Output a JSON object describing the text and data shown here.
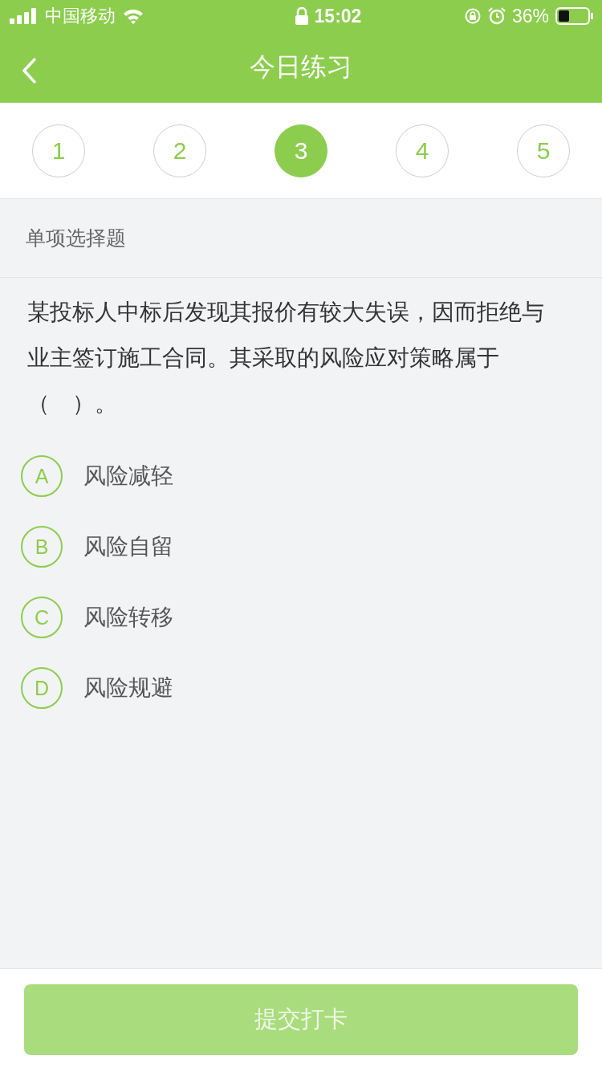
{
  "status_bar": {
    "carrier": "中国移动",
    "time": "15:02",
    "battery": "36%"
  },
  "nav": {
    "title": "今日练习"
  },
  "steps": [
    {
      "label": "1",
      "selected": false
    },
    {
      "label": "2",
      "selected": false
    },
    {
      "label": "3",
      "selected": true
    },
    {
      "label": "4",
      "selected": false
    },
    {
      "label": "5",
      "selected": false
    }
  ],
  "section_title": "单项选择题",
  "question": "某投标人中标后发现其报价有较大失误，因而拒绝与业主签订施工合同。其采取的风险应对策略属于（　）。",
  "options": [
    {
      "letter": "A",
      "text": "风险减轻"
    },
    {
      "letter": "B",
      "text": "风险自留"
    },
    {
      "letter": "C",
      "text": "风险转移"
    },
    {
      "letter": "D",
      "text": "风险规避"
    }
  ],
  "submit": {
    "label": "提交打卡",
    "disabled": true
  }
}
